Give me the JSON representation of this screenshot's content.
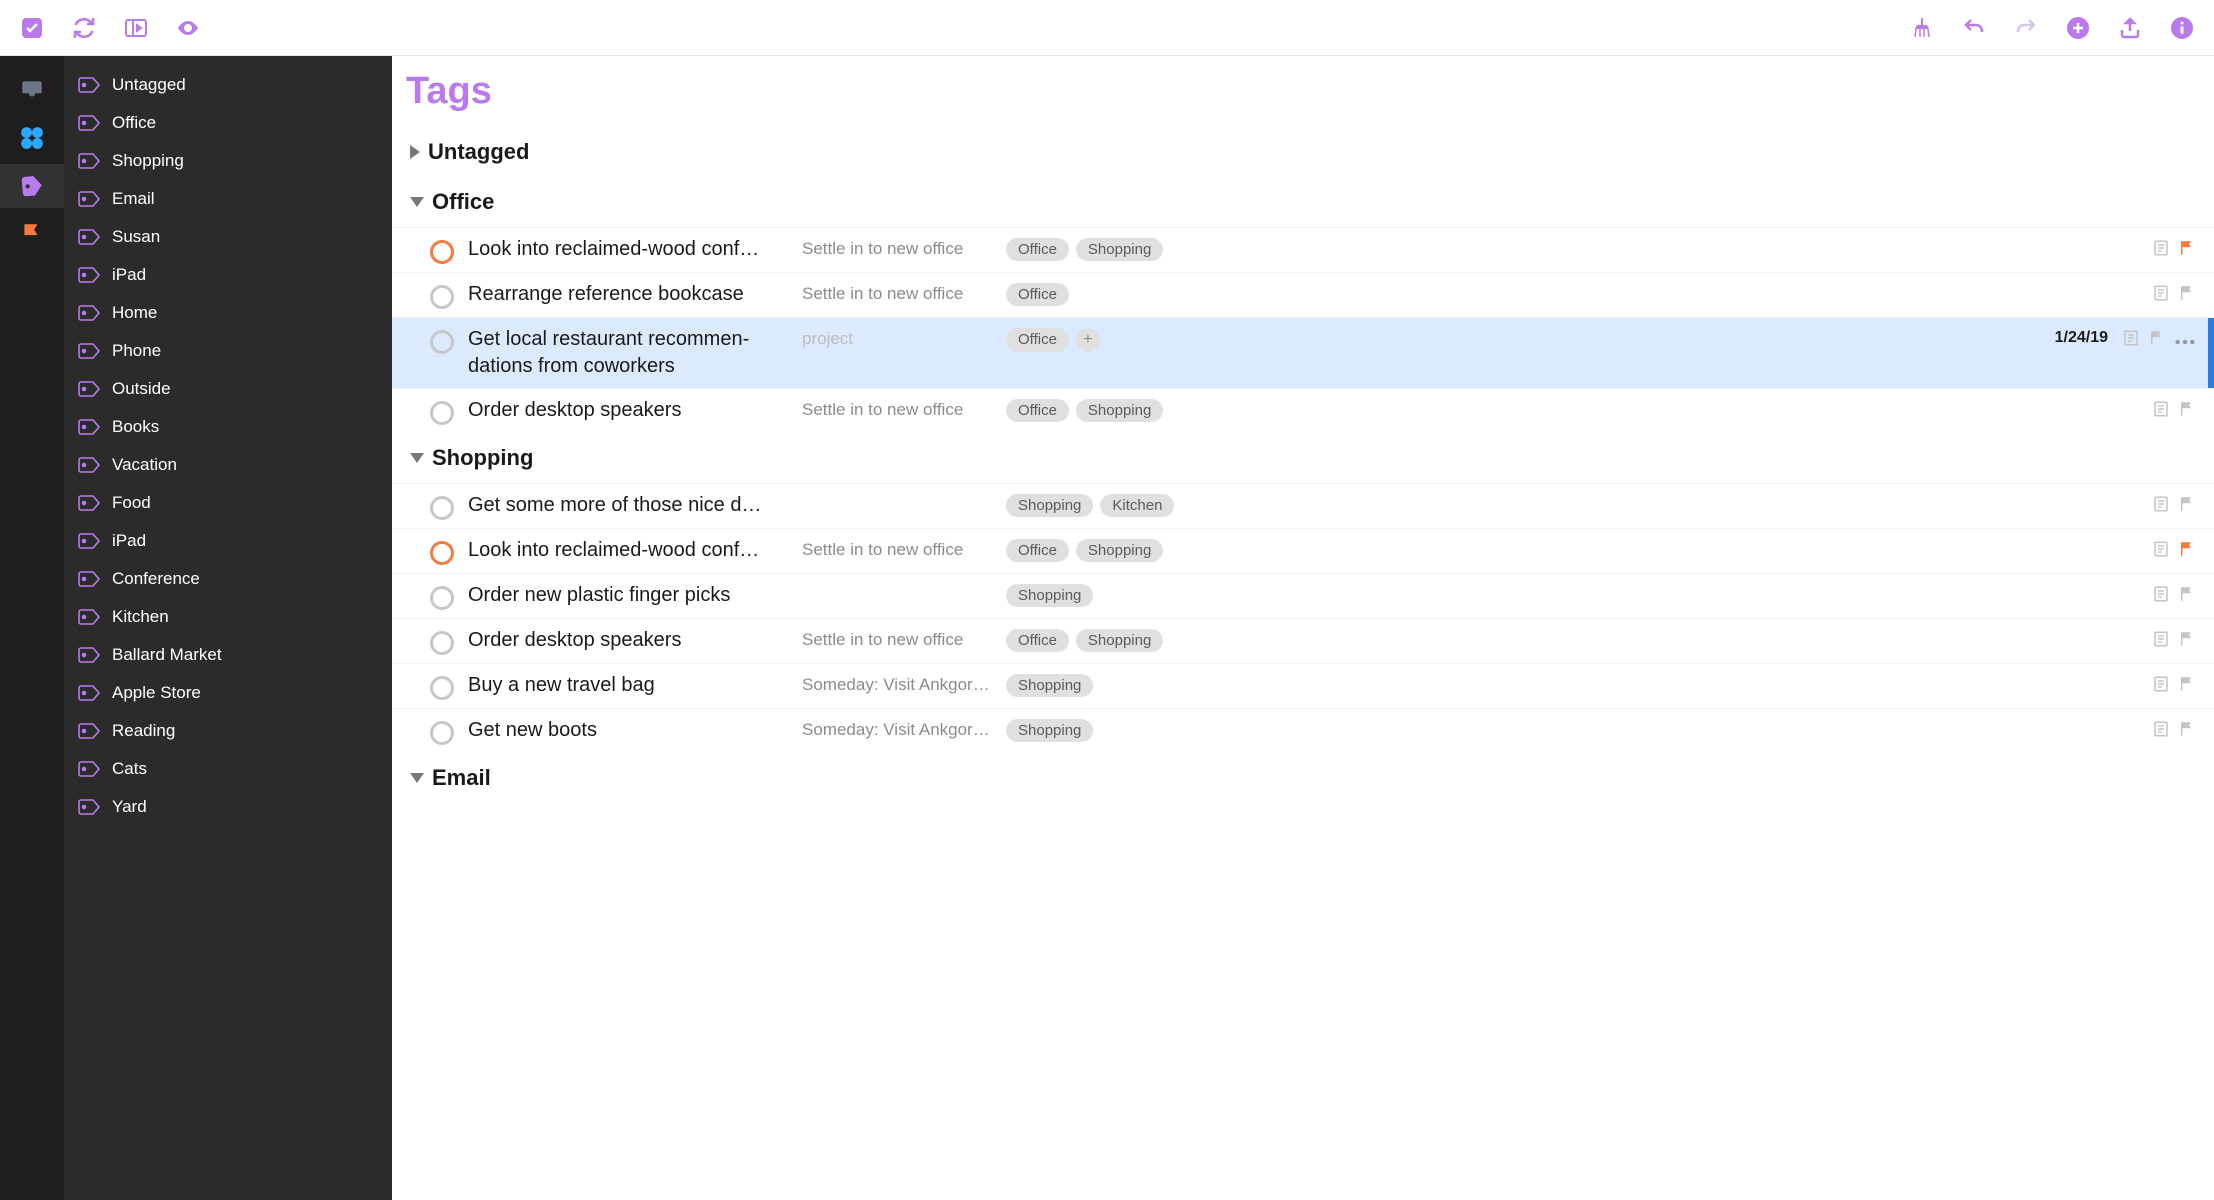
{
  "toolbar": {
    "left": [
      "check",
      "sync",
      "sidebar",
      "eye"
    ],
    "right": [
      "clean",
      "undo",
      "redo",
      "add",
      "share",
      "info"
    ]
  },
  "rail": [
    "inbox",
    "projects",
    "tags",
    "flagged"
  ],
  "sidebar_tags": [
    "Untagged",
    "Office",
    "Shopping",
    "Email",
    "Susan",
    "iPad",
    "Home",
    "Phone",
    "Outside",
    "Books",
    "Vacation",
    "Food",
    "iPad",
    "Conference",
    "Kitchen",
    "Ballard Market",
    "Apple Store",
    "Reading",
    "Cats",
    "Yard"
  ],
  "main": {
    "title": "Tags",
    "sections": [
      {
        "name": "Untagged",
        "collapsed": true,
        "tasks": []
      },
      {
        "name": "Office",
        "collapsed": false,
        "tasks": [
          {
            "title": "Look into reclaimed-wood conf…",
            "trunc": true,
            "project": "Settle in to new office",
            "tags": [
              "Office",
              "Shopping"
            ],
            "due": true,
            "flagged": true,
            "note": true
          },
          {
            "title": "Rearrange reference bookcase",
            "project": "Settle in to new office",
            "tags": [
              "Office"
            ],
            "note": true
          },
          {
            "title": "Get local restaurant recommen­dations from coworkers",
            "project": "project",
            "proj_placeholder": true,
            "tags": [
              "Office"
            ],
            "add_tag": true,
            "date": "1/24/19",
            "note": true,
            "selected": true,
            "more": true
          },
          {
            "title": "Order desktop speakers",
            "project": "Settle in to new office",
            "tags": [
              "Office",
              "Shopping"
            ],
            "note": true
          }
        ]
      },
      {
        "name": "Shopping",
        "collapsed": false,
        "tasks": [
          {
            "title": "Get some more of those nice d…",
            "trunc": true,
            "project": "",
            "tags": [
              "Shopping",
              "Kitchen"
            ],
            "note": true
          },
          {
            "title": "Look into reclaimed-wood conf…",
            "trunc": true,
            "project": "Settle in to new office",
            "tags": [
              "Office",
              "Shopping"
            ],
            "due": true,
            "flagged": true,
            "note": true
          },
          {
            "title": "Order new plastic finger picks",
            "project": "",
            "tags": [
              "Shopping"
            ],
            "note": true
          },
          {
            "title": "Order desktop speakers",
            "project": "Settle in to new office",
            "tags": [
              "Office",
              "Shopping"
            ],
            "note": true
          },
          {
            "title": "Buy a new travel bag",
            "project": "Someday: Visit Ankgor …",
            "tags": [
              "Shopping"
            ],
            "note": true
          },
          {
            "title": "Get new boots",
            "project": "Someday: Visit Ankgor …",
            "tags": [
              "Shopping"
            ],
            "note": true
          }
        ]
      },
      {
        "name": "Email",
        "collapsed": false,
        "tasks": []
      }
    ]
  }
}
